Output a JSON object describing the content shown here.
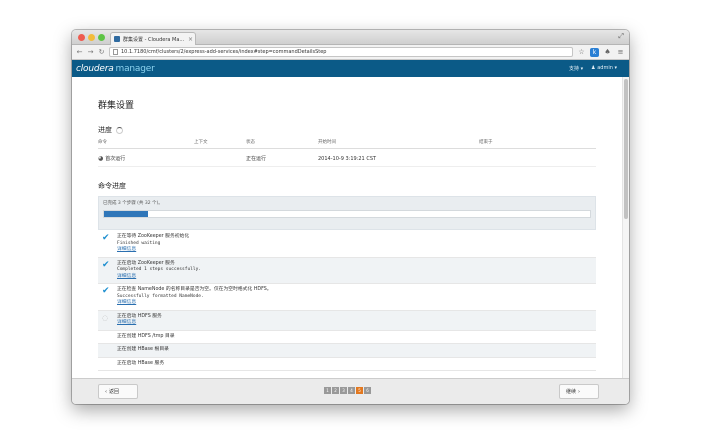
{
  "browser": {
    "tab_title": "群集设置 - Cloudera Ma...",
    "tab_close": "×",
    "url": "10.1.7180/cmf/clusters/2/express-add-services/index#step=commandDetailsStep",
    "resize_icon": "⤢"
  },
  "nav": {
    "brand_primary": "cloudera",
    "brand_secondary": "manager",
    "support_label": "支持 ▾",
    "user_label": "admin ▾"
  },
  "page": {
    "title": "群集设置",
    "progress_section": "进度",
    "table_headers": [
      "命令",
      "上下文",
      "状态",
      "开始时间",
      "结束于"
    ],
    "command_row": {
      "command": "首次运行",
      "context": "",
      "status": "正在运行",
      "start_time": "2014-10-9 3:19:21 CST",
      "end_time": ""
    },
    "command_progress_section": "命令进度",
    "progress_text": "已完成 3 个步骤 (共 32 个)。",
    "progress_fraction": 0.09,
    "steps": [
      {
        "title": "正在等待 ZooKeeper 服务初始化",
        "detail": "Finished waiting",
        "link": "详细信息",
        "status": "done"
      },
      {
        "title": "正在启动 ZooKeeper 服务",
        "detail": "Completed 1 steps successfully.",
        "link": "详细信息",
        "status": "done"
      },
      {
        "title": "正在检查 NameNode 的名称目录是否为空。仅在为空时格式化 HDFS。",
        "detail": "Successfully formatted NameNode.",
        "link": "详细信息",
        "status": "done"
      },
      {
        "title": "正在启动 HDFS 服务",
        "detail": "",
        "link": "详细信息",
        "status": "running"
      },
      {
        "title": "正在创建 HDFS /tmp 目录",
        "detail": "",
        "link": "",
        "status": "pending"
      },
      {
        "title": "正在创建 HBase 根目录",
        "detail": "",
        "link": "",
        "status": "pending"
      },
      {
        "title": "正在启动 HBase 服务",
        "detail": "",
        "link": "",
        "status": "pending"
      }
    ]
  },
  "footer": {
    "back_label": "返回",
    "next_label": "继续",
    "pager": [
      "1",
      "2",
      "3",
      "4",
      "5",
      "6"
    ],
    "active_page_index": 4
  }
}
